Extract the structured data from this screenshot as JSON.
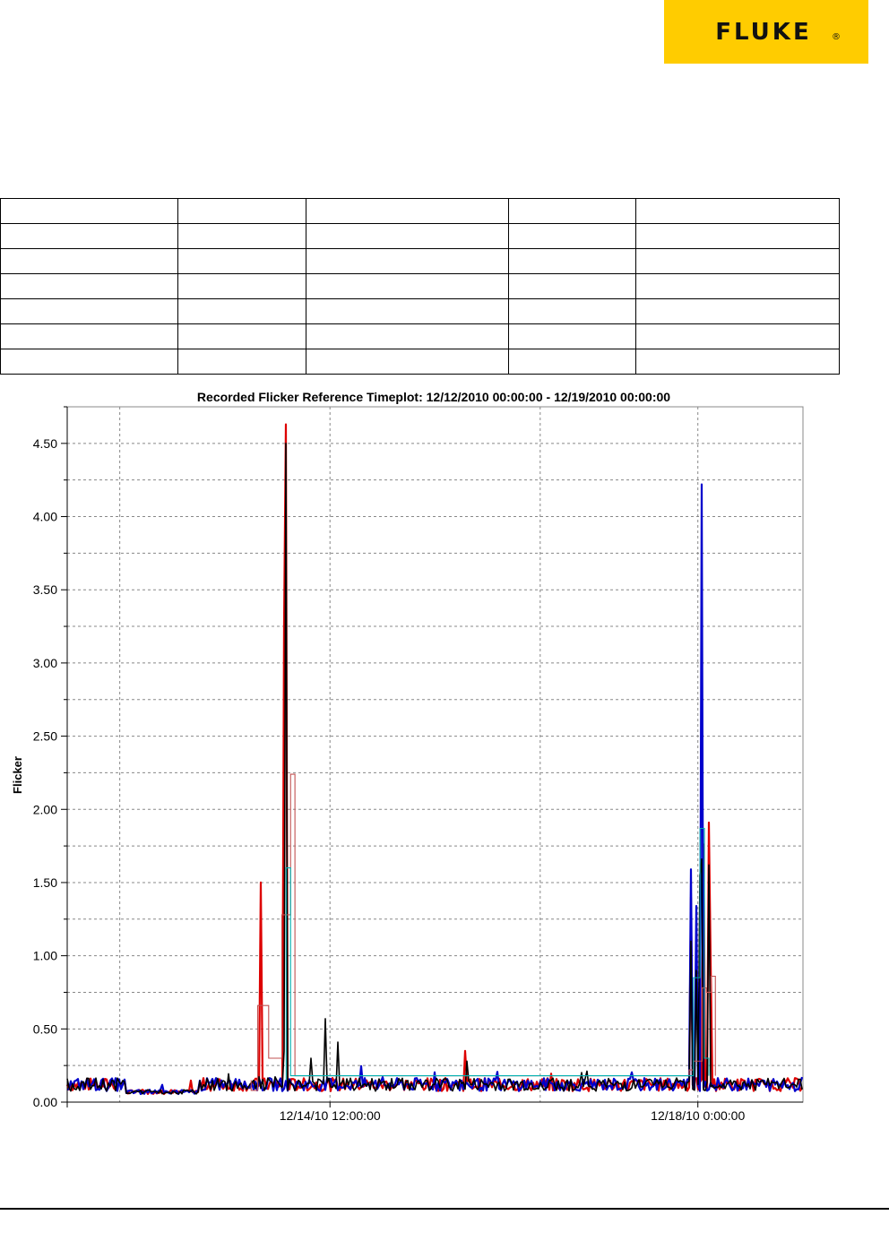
{
  "brand": {
    "name": "FLUKE",
    "registered_mark": "®",
    "background": "#ffcc00"
  },
  "table": {
    "rows": 7,
    "cols": 5
  },
  "chart_data": {
    "type": "line",
    "title": "Recorded Flicker Reference Timeplot: 12/12/2010 00:00:00 - 12/19/2010 00:00:00",
    "ylabel": "Flicker",
    "xlabel": "",
    "x_range": [
      "12/12/2010 00:00:00",
      "12/19/2010 00:00:00"
    ],
    "ylim": [
      0,
      4.75
    ],
    "yticks": [
      0.0,
      0.5,
      1.0,
      1.5,
      2.0,
      2.5,
      3.0,
      3.5,
      4.0,
      4.5
    ],
    "ytick_labels": [
      "0.00",
      "0.50",
      "1.00",
      "1.50",
      "2.00",
      "2.50",
      "3.00",
      "3.50",
      "4.00",
      "4.50"
    ],
    "xtick_labels": [
      {
        "x": "12/14/2010 12:00:00",
        "label": "12/14/10 12:00:00"
      },
      {
        "x": "12/18/2010 00:00:00",
        "label": "12/18/10 0:00:00"
      }
    ],
    "x_gridlines": [
      "12/12/2010 12:00:00",
      "12/14/2010 12:00:00",
      "12/16/2010 12:00:00",
      "12/18/2010 00:00:00"
    ],
    "grid": true,
    "series": [
      {
        "color": "#dd0000",
        "style": "line",
        "baseline": 0.12,
        "spikes": [
          {
            "x": "12/13/2010 20:00:00",
            "y": 1.5
          },
          {
            "x": "12/14/2010 01:45:00",
            "y": 4.63
          },
          {
            "x": "12/14/2010 01:40:00",
            "y": 3.27
          },
          {
            "x": "12/15/2010 19:00:00",
            "y": 0.35
          },
          {
            "x": "12/18/2010 01:15:00",
            "y": 1.76
          },
          {
            "x": "12/18/2010 02:20:00",
            "y": 1.91
          },
          {
            "x": "12/17/2010 22:30:00",
            "y": 1.4
          },
          {
            "x": "12/18/2010 02:50:00",
            "y": 0.95
          }
        ]
      },
      {
        "color": "#0000cc",
        "style": "line",
        "baseline": 0.12,
        "spikes": [
          {
            "x": "12/18/2010 00:45:00",
            "y": 4.22
          },
          {
            "x": "12/17/2010 22:20:00",
            "y": 1.59
          },
          {
            "x": "12/17/2010 23:30:00",
            "y": 1.34
          }
        ]
      },
      {
        "color": "#000000",
        "style": "line",
        "baseline": 0.12,
        "spikes": [
          {
            "x": "12/14/2010 01:50:00",
            "y": 4.5
          },
          {
            "x": "12/14/2010 01:20:00",
            "y": 0.35
          },
          {
            "x": "12/14/2010 07:30:00",
            "y": 0.3
          },
          {
            "x": "12/14/2010 11:00:00",
            "y": 0.57
          },
          {
            "x": "12/14/2010 14:00:00",
            "y": 0.41
          },
          {
            "x": "12/15/2010 19:10:00",
            "y": 0.28
          },
          {
            "x": "12/18/2010 00:20:00",
            "y": 1.55
          },
          {
            "x": "12/18/2010 00:55:00",
            "y": 1.66
          },
          {
            "x": "12/18/2010 02:40:00",
            "y": 1.62
          },
          {
            "x": "12/17/2010 22:30:00",
            "y": 1.1
          },
          {
            "x": "12/17/2010 23:40:00",
            "y": 0.9
          }
        ]
      },
      {
        "color": "#c05050",
        "style": "step",
        "points": [
          {
            "x": "12/13/2010 18:00:00",
            "y": 0.08
          },
          {
            "x": "12/13/2010 19:30:00",
            "y": 0.66
          },
          {
            "x": "12/13/2010 22:00:00",
            "y": 0.3
          },
          {
            "x": "12/14/2010 01:00:00",
            "y": 1.28
          },
          {
            "x": "12/14/2010 03:00:00",
            "y": 2.24
          },
          {
            "x": "12/14/2010 04:00:00",
            "y": 0.18
          },
          {
            "x": "12/17/2010 22:00:00",
            "y": 0.22
          },
          {
            "x": "12/17/2010 23:00:00",
            "y": 0.28
          },
          {
            "x": "12/18/2010 01:00:00",
            "y": 0.78
          },
          {
            "x": "12/18/2010 02:00:00",
            "y": 0.75
          },
          {
            "x": "12/18/2010 03:00:00",
            "y": 0.86
          },
          {
            "x": "12/18/2010 04:00:00",
            "y": 0.18
          }
        ]
      },
      {
        "color": "#00b0b0",
        "style": "step",
        "points": [
          {
            "x": "12/14/2010 02:00:00",
            "y": 1.6
          },
          {
            "x": "12/14/2010 03:00:00",
            "y": 0.18
          },
          {
            "x": "12/17/2010 23:00:00",
            "y": 0.85
          },
          {
            "x": "12/18/2010 00:30:00",
            "y": 1.87
          },
          {
            "x": "12/18/2010 01:30:00",
            "y": 0.3
          },
          {
            "x": "12/18/2010 02:30:00",
            "y": 0.18
          }
        ]
      }
    ]
  }
}
